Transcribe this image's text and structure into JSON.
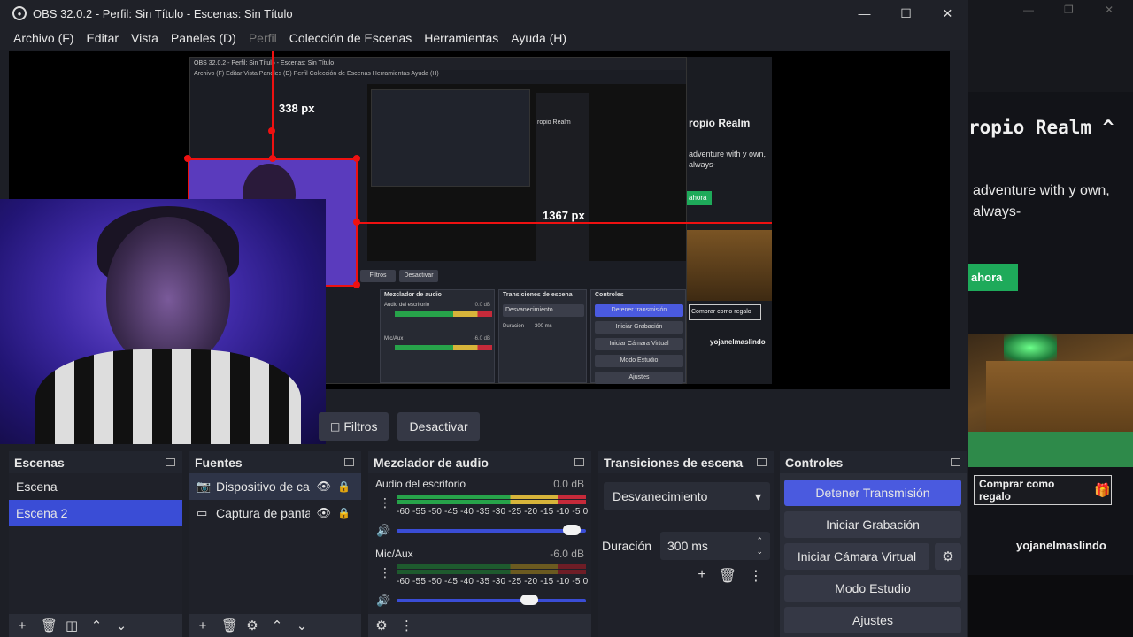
{
  "window": {
    "title": "OBS 32.0.2 - Perfil: Sin Título - Escenas: Sin Título",
    "min": "—",
    "max": "☐",
    "close": "✕"
  },
  "menu": [
    "Archivo (F)",
    "Editar",
    "Vista",
    "Paneles (D)",
    "Perfil",
    "Colección de Escenas",
    "Herramientas",
    "Ayuda (H)"
  ],
  "preview": {
    "label_338": "338 px",
    "label_1367": "1367 px",
    "nested_title": "OBS 32.0.2 - Perfil: Sin Título - Escenas: Sin Título",
    "nested_menu": "Archivo (F)   Editar   Vista   Paneles (D)   Perfil   Colección de Escenas   Herramientas   Ayuda (H)",
    "nested_mixer": "Mezclador de audio",
    "nested_trans": "Transiciones de escena",
    "nested_ctrl": "Controles",
    "nested_desktop": "Audio del escritorio",
    "nested_mic": "Mic/Aux",
    "nested_fade": "Desvanecimiento",
    "nested_dur": "Duración",
    "nested_ms": "300 ms",
    "nested_stop": "Detener transmisión",
    "nested_rec": "Iniciar Grabación",
    "nested_vcam": "Iniciar Cámara Virtual",
    "nested_studio": "Modo Estudio",
    "nested_settings": "Ajustes",
    "nested_filters": "Filtros",
    "nested_deact": "Desactivar",
    "nested_gift": "Comprar como regalo",
    "nested_user": "yojanelmaslindo",
    "nested_realm": "ropio Realm",
    "nested_adv": "adventure with y own, always-",
    "nested_ahora": "ahora",
    "nested_db0": "0.0 dB",
    "nested_db6": "-6.0 dB"
  },
  "filterbar": {
    "filters": "Filtros",
    "deactivate": "Desactivar"
  },
  "scenes": {
    "title": "Escenas",
    "items": [
      "Escena",
      "Escena 2"
    ]
  },
  "sources": {
    "title": "Fuentes",
    "items": [
      {
        "name": "Dispositivo de captura de video",
        "icon": "camera-icon"
      },
      {
        "name": "Captura de pantalla",
        "icon": "monitor-icon"
      }
    ]
  },
  "mixer": {
    "title": "Mezclador de audio",
    "scale": "-60 -55 -50 -45 -40 -35 -30 -25 -20 -15 -10 -5  0",
    "channels": [
      {
        "name": "Audio del escritorio",
        "db": "0.0 dB",
        "level": 0.97
      },
      {
        "name": "Mic/Aux",
        "db": "-6.0 dB",
        "level": 0.72
      }
    ]
  },
  "transitions": {
    "title": "Transiciones de escena",
    "selected": "Desvanecimiento",
    "duration_label": "Duración",
    "duration_value": "300 ms"
  },
  "controls": {
    "title": "Controles",
    "stop_stream": "Detener Transmisión",
    "start_rec": "Iniciar Grabación",
    "start_vcam": "Iniciar Cámara Virtual",
    "studio": "Modo Estudio",
    "settings": "Ajustes"
  },
  "right_panel": {
    "title": "ropio Realm",
    "chevron": "^",
    "text": "adventure with y own, always-",
    "green_btn": "ahora",
    "gift_btn": "Comprar como regalo",
    "user": "yojanelmaslindo"
  }
}
